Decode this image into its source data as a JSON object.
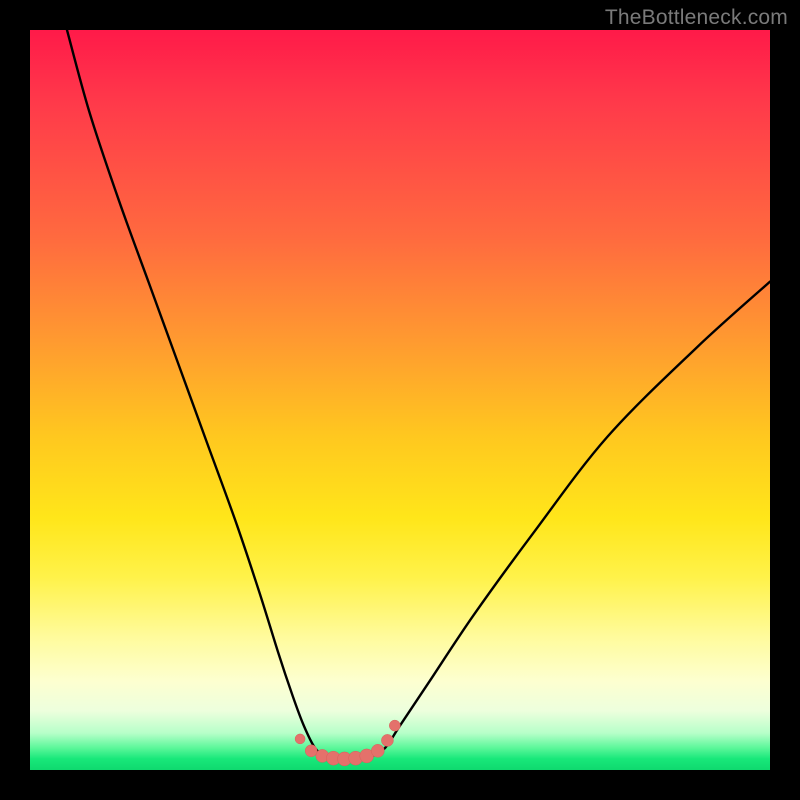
{
  "watermark": "TheBottleneck.com",
  "colors": {
    "frame": "#000000",
    "curve_stroke": "#000000",
    "marker_fill": "#e4716b",
    "marker_stroke": "#d85f5a"
  },
  "chart_data": {
    "type": "line",
    "title": "",
    "xlabel": "",
    "ylabel": "",
    "xlim": [
      0,
      100
    ],
    "ylim": [
      0,
      100
    ],
    "note": "No numeric axis ticks or labels are visible in the image; x/y values below are estimated from pixel positions on a 0–100 normalized scale.",
    "series": [
      {
        "name": "bottleneck-curve",
        "x": [
          5,
          8,
          12,
          16,
          20,
          24,
          28,
          31,
          33.5,
          35.5,
          37,
          38.5,
          40,
          42,
          44,
          46,
          48,
          50,
          54,
          60,
          68,
          78,
          90,
          100
        ],
        "y": [
          100,
          89,
          77,
          66,
          55,
          44,
          33,
          24,
          16,
          10,
          6,
          3,
          1.8,
          1.5,
          1.5,
          1.8,
          3,
          6,
          12,
          21,
          32,
          45,
          57,
          66
        ]
      }
    ],
    "markers": {
      "name": "trough-markers",
      "x": [
        36.5,
        38,
        39.5,
        41,
        42.5,
        44,
        45.5,
        47,
        48.3,
        49.3
      ],
      "y": [
        4.2,
        2.6,
        1.9,
        1.6,
        1.5,
        1.6,
        1.9,
        2.6,
        4.0,
        6.0
      ],
      "r": [
        5,
        6,
        6.5,
        7,
        7,
        7,
        7,
        6.5,
        6,
        5.5
      ]
    }
  }
}
